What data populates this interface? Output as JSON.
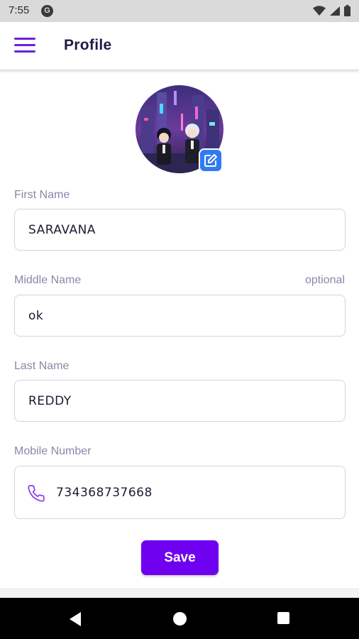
{
  "status_bar": {
    "time": "7:55",
    "app_icon_letter": "G"
  },
  "app_bar": {
    "menu_icon": "hamburger-menu-icon",
    "title": "Profile"
  },
  "avatar": {
    "image": "anime-characters-neon-city-avatar",
    "edit_icon": "edit-square-icon"
  },
  "form": {
    "first_name": {
      "label": "First Name",
      "value": "SARAVANA"
    },
    "middle_name": {
      "label": "Middle Name",
      "hint": "optional",
      "value": "ok"
    },
    "last_name": {
      "label": "Last Name",
      "value": "REDDY"
    },
    "mobile_number": {
      "label": "Mobile Number",
      "icon": "phone-icon",
      "value": "734368737668"
    }
  },
  "save_button": {
    "label": "Save"
  },
  "colors": {
    "accent": "#7000f0",
    "edit_badge": "#2f7bf2",
    "label": "#8d86a8",
    "title": "#1f1a46"
  },
  "nav_bar": {
    "back_icon": "back-triangle-icon",
    "home_icon": "home-circle-icon",
    "recents_icon": "recents-square-icon"
  }
}
